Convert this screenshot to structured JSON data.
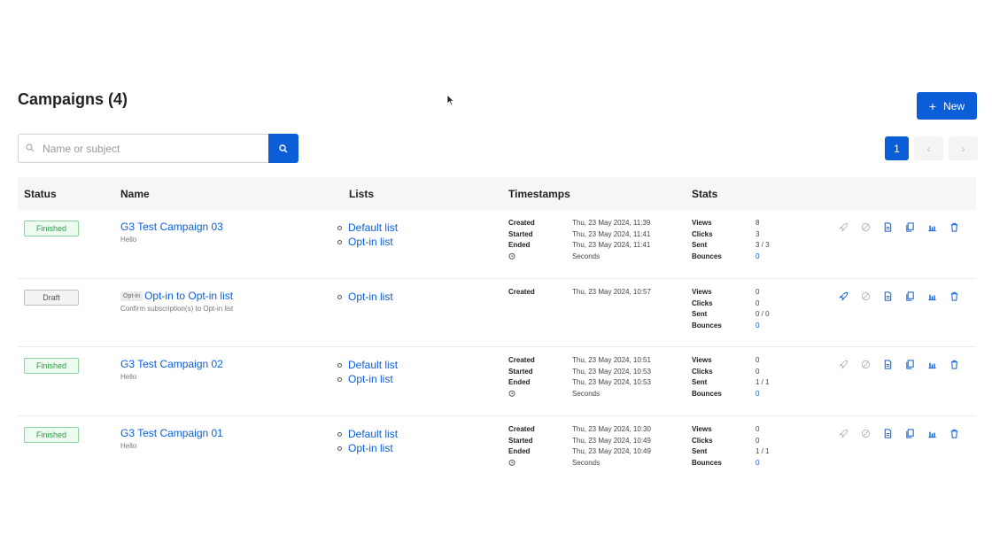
{
  "header": {
    "title": "Campaigns (4)",
    "new_button": "New"
  },
  "search": {
    "placeholder": "Name or subject",
    "value": ""
  },
  "pagination": {
    "current": "1",
    "prev": "‹",
    "next": "›"
  },
  "table": {
    "columns": [
      "Status",
      "Name",
      "Lists",
      "Timestamps",
      "Stats"
    ],
    "rows": [
      {
        "status": "Finished",
        "name": "G3 Test Campaign 03",
        "tag": "",
        "subject": "Hello",
        "lists": [
          "Default list",
          "Opt-in list"
        ],
        "timestamps": {
          "created_label": "Created",
          "created": "Thu, 23 May 2024, 11:39",
          "started_label": "Started",
          "started": "Thu, 23 May 2024, 11:41",
          "ended_label": "Ended",
          "ended": "Thu, 23 May 2024, 11:41",
          "duration": "Seconds"
        },
        "stats": {
          "views_label": "Views",
          "views": "8",
          "clicks_label": "Clicks",
          "clicks": "3",
          "sent_label": "Sent",
          "sent": "3 / 3",
          "bounces_label": "Bounces",
          "bounces": "0"
        }
      },
      {
        "status": "Draft",
        "name": "Opt-in to Opt-in list",
        "tag": "Opt-in",
        "subject": "Confirm subscription(s) to Opt-in list",
        "lists": [
          "Opt-in list"
        ],
        "timestamps": {
          "created_label": "Created",
          "created": "Thu, 23 May 2024, 10:57"
        },
        "stats": {
          "views_label": "Views",
          "views": "0",
          "clicks_label": "Clicks",
          "clicks": "0",
          "sent_label": "Sent",
          "sent": "0 / 0",
          "bounces_label": "Bounces",
          "bounces": "0"
        }
      },
      {
        "status": "Finished",
        "name": "G3 Test Campaign 02",
        "tag": "",
        "subject": "Hello",
        "lists": [
          "Default list",
          "Opt-in list"
        ],
        "timestamps": {
          "created_label": "Created",
          "created": "Thu, 23 May 2024, 10:51",
          "started_label": "Started",
          "started": "Thu, 23 May 2024, 10:53",
          "ended_label": "Ended",
          "ended": "Thu, 23 May 2024, 10:53",
          "duration": "Seconds"
        },
        "stats": {
          "views_label": "Views",
          "views": "0",
          "clicks_label": "Clicks",
          "clicks": "0",
          "sent_label": "Sent",
          "sent": "1 / 1",
          "bounces_label": "Bounces",
          "bounces": "0"
        }
      },
      {
        "status": "Finished",
        "name": "G3 Test Campaign 01",
        "tag": "",
        "subject": "Hello",
        "lists": [
          "Default list",
          "Opt-in list"
        ],
        "timestamps": {
          "created_label": "Created",
          "created": "Thu, 23 May 2024, 10:30",
          "started_label": "Started",
          "started": "Thu, 23 May 2024, 10:49",
          "ended_label": "Ended",
          "ended": "Thu, 23 May 2024, 10:49",
          "duration": "Seconds"
        },
        "stats": {
          "views_label": "Views",
          "views": "0",
          "clicks_label": "Clicks",
          "clicks": "0",
          "sent_label": "Sent",
          "sent": "1 / 1",
          "bounces_label": "Bounces",
          "bounces": "0"
        }
      }
    ]
  },
  "colors": {
    "primary": "#0b5ed7",
    "finished": "#2e9a47",
    "draft": "#555555",
    "disabled_icon": "#b5b5b5"
  },
  "icons": [
    "search-icon",
    "plus-icon",
    "rocket-icon",
    "cancel-icon",
    "preview-icon",
    "clone-icon",
    "chart-icon",
    "trash-icon",
    "clock-icon"
  ]
}
